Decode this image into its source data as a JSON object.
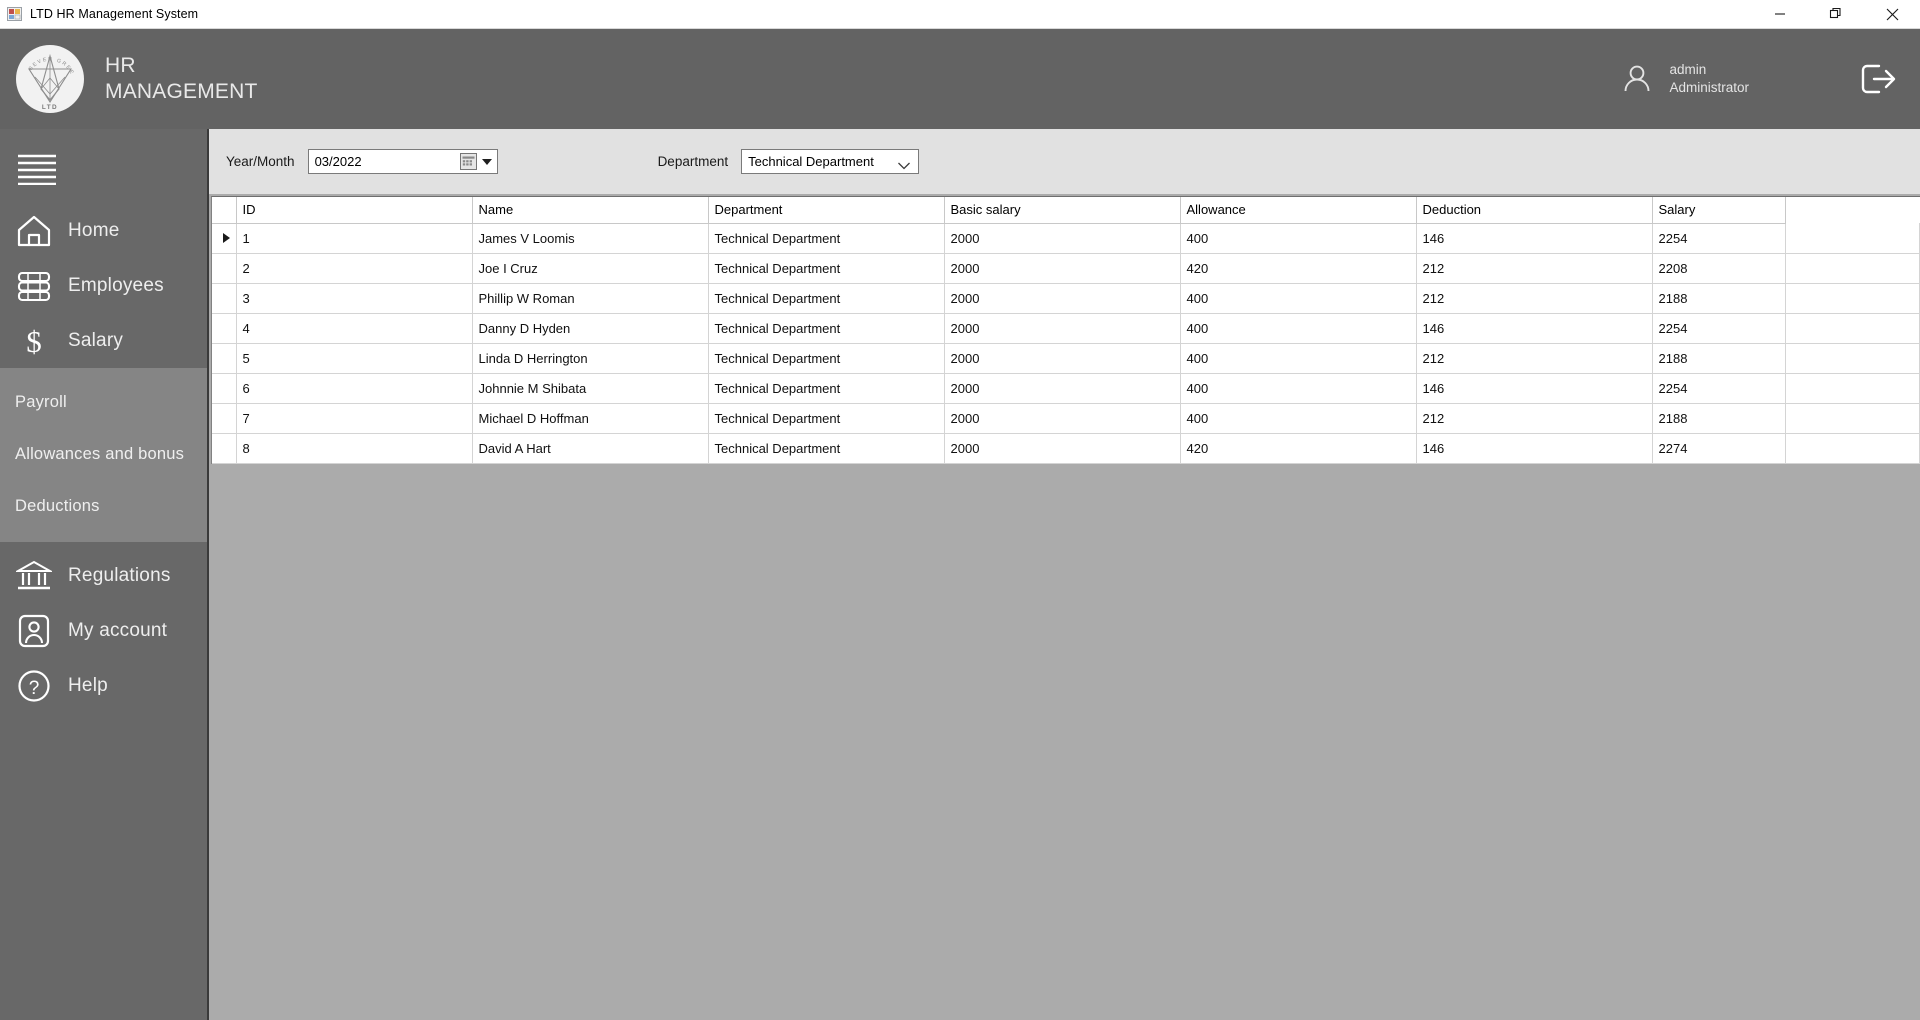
{
  "window": {
    "title": "LTD HR Management System",
    "icon": "app-window-icon",
    "controls": {
      "minimize": "minimize-icon",
      "restore": "restore-icon",
      "close": "close-icon"
    }
  },
  "header": {
    "brand_line1": "HR",
    "brand_line2": "MANAGEMENT",
    "logo_text_top": "SEVEN GREEN",
    "logo_text_bottom": "LTD",
    "user": {
      "name": "admin",
      "role": "Administrator",
      "icon": "user-icon"
    },
    "logout_icon": "logout-icon",
    "bg_color": "#636363"
  },
  "sidebar": {
    "bg_color": "#686868",
    "submenu_bg_color": "#858585",
    "menu_icon": "hamburger-icon",
    "items": [
      {
        "label": "Home",
        "icon": "home-icon"
      },
      {
        "label": "Employees",
        "icon": "employees-icon"
      },
      {
        "label": "Salary",
        "icon": "dollar-icon"
      }
    ],
    "submenu": [
      {
        "label": "Payroll"
      },
      {
        "label": "Allowances and bonus"
      },
      {
        "label": "Deductions"
      }
    ],
    "items_bottom": [
      {
        "label": "Regulations",
        "icon": "bank-icon"
      },
      {
        "label": "My account",
        "icon": "account-icon"
      },
      {
        "label": "Help",
        "icon": "help-icon"
      }
    ]
  },
  "filters": {
    "year_month_label": "Year/Month",
    "year_month_value": "03/2022",
    "year_month_icon": "calendar-icon",
    "department_label": "Department",
    "department_value": "Technical Department",
    "department_icon": "chevron-down-icon"
  },
  "grid": {
    "columns": [
      "ID",
      "Name",
      "Department",
      "Basic salary",
      "Allowance",
      "Deduction",
      "Salary"
    ],
    "selected_row_index": 0,
    "selection_color": "#0c7ac9",
    "rows": [
      {
        "id": "1",
        "name": "James V Loomis",
        "department": "Technical Department",
        "basic_salary": "2000",
        "allowance": "400",
        "deduction": "146",
        "salary": "2254"
      },
      {
        "id": "2",
        "name": "Joe I Cruz",
        "department": "Technical Department",
        "basic_salary": "2000",
        "allowance": "420",
        "deduction": "212",
        "salary": "2208"
      },
      {
        "id": "3",
        "name": "Phillip W Roman",
        "department": "Technical Department",
        "basic_salary": "2000",
        "allowance": "400",
        "deduction": "212",
        "salary": "2188"
      },
      {
        "id": "4",
        "name": "Danny D Hyden",
        "department": "Technical Department",
        "basic_salary": "2000",
        "allowance": "400",
        "deduction": "146",
        "salary": "2254"
      },
      {
        "id": "5",
        "name": "Linda D Herrington",
        "department": "Technical Department",
        "basic_salary": "2000",
        "allowance": "400",
        "deduction": "212",
        "salary": "2188"
      },
      {
        "id": "6",
        "name": "Johnnie M Shibata",
        "department": "Technical Department",
        "basic_salary": "2000",
        "allowance": "400",
        "deduction": "146",
        "salary": "2254"
      },
      {
        "id": "7",
        "name": "Michael D Hoffman",
        "department": "Technical Department",
        "basic_salary": "2000",
        "allowance": "400",
        "deduction": "212",
        "salary": "2188"
      },
      {
        "id": "8",
        "name": "David A Hart",
        "department": "Technical Department",
        "basic_salary": "2000",
        "allowance": "420",
        "deduction": "146",
        "salary": "2274"
      }
    ]
  }
}
